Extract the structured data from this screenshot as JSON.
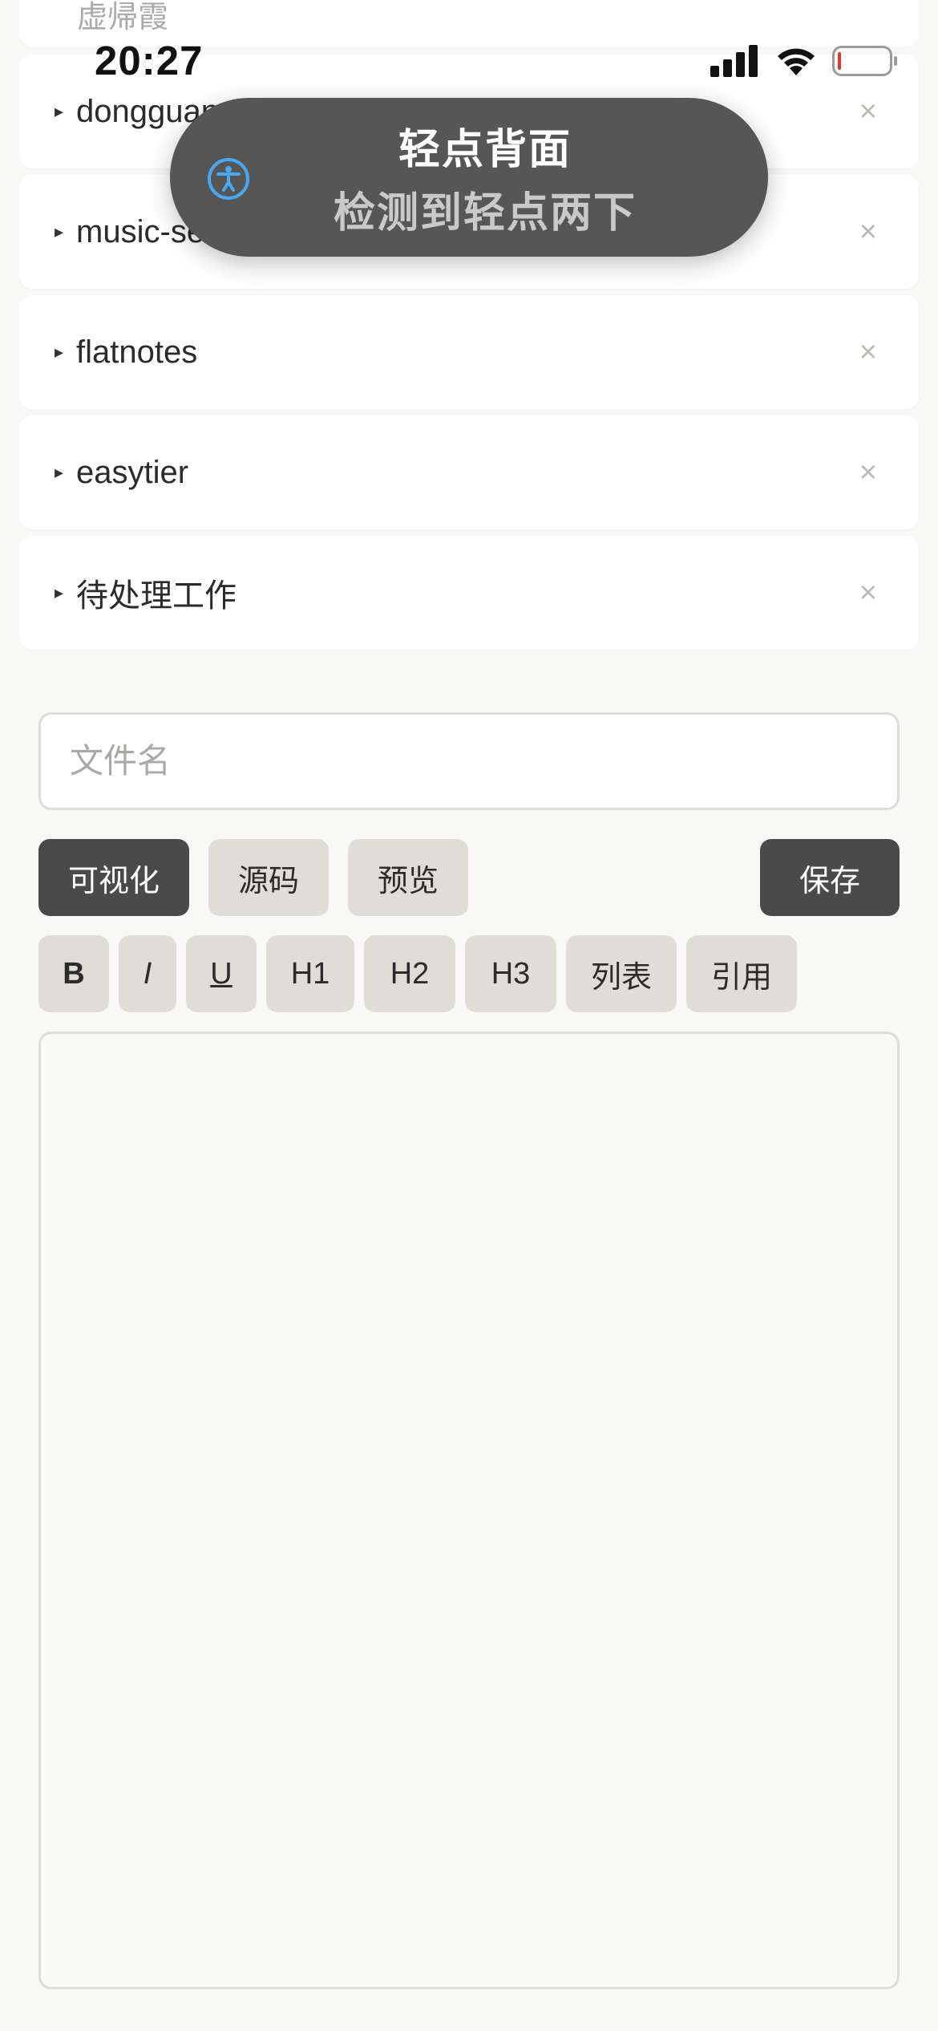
{
  "status_bar": {
    "time": "20:27"
  },
  "cut_item": {
    "label": "虚帰霞"
  },
  "list": {
    "items": [
      {
        "label": "dongguan"
      },
      {
        "label": "music-server"
      },
      {
        "label": "flatnotes"
      },
      {
        "label": "easytier"
      },
      {
        "label": "待处理工作"
      }
    ],
    "remove_symbol": "×",
    "expand_symbol": "▸"
  },
  "toast": {
    "title": "轻点背面",
    "subtitle": "检测到轻点两下",
    "icon": "accessibility-icon"
  },
  "editor": {
    "filename_placeholder": "文件名",
    "modes": {
      "visual": "可视化",
      "source": "源码",
      "preview": "预览"
    },
    "save_label": "保存",
    "format": {
      "bold": "B",
      "italic": "I",
      "underline": "U",
      "h1": "H1",
      "h2": "H2",
      "h3": "H3",
      "list": "列表",
      "quote": "引用"
    }
  },
  "colors": {
    "background": "#f8f8f6",
    "dark_button": "#4a4a4a",
    "light_button": "#e0ddd6",
    "toast_bg": "#565656",
    "accessibility_blue": "#4aa8f0"
  }
}
